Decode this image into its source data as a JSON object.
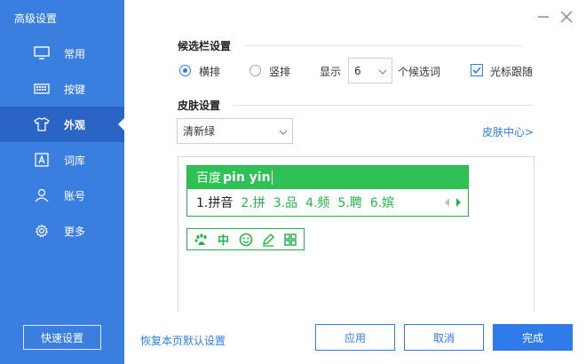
{
  "window": {
    "title": "高级设置"
  },
  "sidebar": {
    "items": [
      {
        "label": "常用",
        "icon": "monitor-icon"
      },
      {
        "label": "按键",
        "icon": "keyboard-icon"
      },
      {
        "label": "外观",
        "icon": "tshirt-icon",
        "active": true
      },
      {
        "label": "词库",
        "icon": "dictionary-icon"
      },
      {
        "label": "账号",
        "icon": "user-icon"
      },
      {
        "label": "更多",
        "icon": "gear-icon"
      }
    ],
    "quick_setup": "快速设置"
  },
  "candidate_bar": {
    "title": "候选栏设置",
    "horizontal": "横排",
    "vertical": "竖排",
    "selected": "横排",
    "show_label": "显示",
    "count": "6",
    "count_suffix": "个候选词",
    "cursor_follow": "光标跟随",
    "cursor_follow_checked": true
  },
  "skin": {
    "title": "皮肤设置",
    "selected": "清新绿",
    "center_link": "皮肤中心>"
  },
  "preview": {
    "brand": "百度",
    "pinyin": "pin yin",
    "candidates": [
      "1.拼音",
      "2.拼",
      "3.品",
      "4.频",
      "5.聘",
      "6.嫔"
    ],
    "toolbar": [
      "paw-icon",
      "chinese-mode-icon",
      "emoji-icon",
      "pen-icon",
      "grid-icon"
    ],
    "toolbar_text": {
      "mode": "中"
    },
    "colors": {
      "skin": "#2fc156",
      "accent": "#3a7fe0"
    }
  },
  "footer": {
    "restore_default": "恢复本页默认设置",
    "apply": "应用",
    "cancel": "取消",
    "done": "完成"
  }
}
